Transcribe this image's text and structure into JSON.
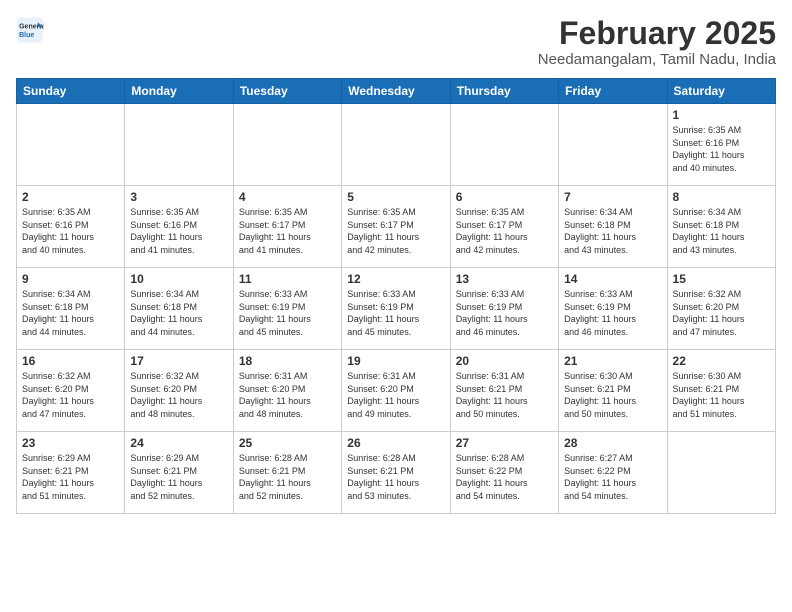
{
  "header": {
    "logo_line1": "General",
    "logo_line2": "Blue",
    "month": "February 2025",
    "location": "Needamangalam, Tamil Nadu, India"
  },
  "days_of_week": [
    "Sunday",
    "Monday",
    "Tuesday",
    "Wednesday",
    "Thursday",
    "Friday",
    "Saturday"
  ],
  "weeks": [
    [
      {
        "day": "",
        "info": ""
      },
      {
        "day": "",
        "info": ""
      },
      {
        "day": "",
        "info": ""
      },
      {
        "day": "",
        "info": ""
      },
      {
        "day": "",
        "info": ""
      },
      {
        "day": "",
        "info": ""
      },
      {
        "day": "1",
        "info": "Sunrise: 6:35 AM\nSunset: 6:16 PM\nDaylight: 11 hours\nand 40 minutes."
      }
    ],
    [
      {
        "day": "2",
        "info": "Sunrise: 6:35 AM\nSunset: 6:16 PM\nDaylight: 11 hours\nand 40 minutes."
      },
      {
        "day": "3",
        "info": "Sunrise: 6:35 AM\nSunset: 6:16 PM\nDaylight: 11 hours\nand 41 minutes."
      },
      {
        "day": "4",
        "info": "Sunrise: 6:35 AM\nSunset: 6:17 PM\nDaylight: 11 hours\nand 41 minutes."
      },
      {
        "day": "5",
        "info": "Sunrise: 6:35 AM\nSunset: 6:17 PM\nDaylight: 11 hours\nand 42 minutes."
      },
      {
        "day": "6",
        "info": "Sunrise: 6:35 AM\nSunset: 6:17 PM\nDaylight: 11 hours\nand 42 minutes."
      },
      {
        "day": "7",
        "info": "Sunrise: 6:34 AM\nSunset: 6:18 PM\nDaylight: 11 hours\nand 43 minutes."
      },
      {
        "day": "8",
        "info": "Sunrise: 6:34 AM\nSunset: 6:18 PM\nDaylight: 11 hours\nand 43 minutes."
      }
    ],
    [
      {
        "day": "9",
        "info": "Sunrise: 6:34 AM\nSunset: 6:18 PM\nDaylight: 11 hours\nand 44 minutes."
      },
      {
        "day": "10",
        "info": "Sunrise: 6:34 AM\nSunset: 6:18 PM\nDaylight: 11 hours\nand 44 minutes."
      },
      {
        "day": "11",
        "info": "Sunrise: 6:33 AM\nSunset: 6:19 PM\nDaylight: 11 hours\nand 45 minutes."
      },
      {
        "day": "12",
        "info": "Sunrise: 6:33 AM\nSunset: 6:19 PM\nDaylight: 11 hours\nand 45 minutes."
      },
      {
        "day": "13",
        "info": "Sunrise: 6:33 AM\nSunset: 6:19 PM\nDaylight: 11 hours\nand 46 minutes."
      },
      {
        "day": "14",
        "info": "Sunrise: 6:33 AM\nSunset: 6:19 PM\nDaylight: 11 hours\nand 46 minutes."
      },
      {
        "day": "15",
        "info": "Sunrise: 6:32 AM\nSunset: 6:20 PM\nDaylight: 11 hours\nand 47 minutes."
      }
    ],
    [
      {
        "day": "16",
        "info": "Sunrise: 6:32 AM\nSunset: 6:20 PM\nDaylight: 11 hours\nand 47 minutes."
      },
      {
        "day": "17",
        "info": "Sunrise: 6:32 AM\nSunset: 6:20 PM\nDaylight: 11 hours\nand 48 minutes."
      },
      {
        "day": "18",
        "info": "Sunrise: 6:31 AM\nSunset: 6:20 PM\nDaylight: 11 hours\nand 48 minutes."
      },
      {
        "day": "19",
        "info": "Sunrise: 6:31 AM\nSunset: 6:20 PM\nDaylight: 11 hours\nand 49 minutes."
      },
      {
        "day": "20",
        "info": "Sunrise: 6:31 AM\nSunset: 6:21 PM\nDaylight: 11 hours\nand 50 minutes."
      },
      {
        "day": "21",
        "info": "Sunrise: 6:30 AM\nSunset: 6:21 PM\nDaylight: 11 hours\nand 50 minutes."
      },
      {
        "day": "22",
        "info": "Sunrise: 6:30 AM\nSunset: 6:21 PM\nDaylight: 11 hours\nand 51 minutes."
      }
    ],
    [
      {
        "day": "23",
        "info": "Sunrise: 6:29 AM\nSunset: 6:21 PM\nDaylight: 11 hours\nand 51 minutes."
      },
      {
        "day": "24",
        "info": "Sunrise: 6:29 AM\nSunset: 6:21 PM\nDaylight: 11 hours\nand 52 minutes."
      },
      {
        "day": "25",
        "info": "Sunrise: 6:28 AM\nSunset: 6:21 PM\nDaylight: 11 hours\nand 52 minutes."
      },
      {
        "day": "26",
        "info": "Sunrise: 6:28 AM\nSunset: 6:21 PM\nDaylight: 11 hours\nand 53 minutes."
      },
      {
        "day": "27",
        "info": "Sunrise: 6:28 AM\nSunset: 6:22 PM\nDaylight: 11 hours\nand 54 minutes."
      },
      {
        "day": "28",
        "info": "Sunrise: 6:27 AM\nSunset: 6:22 PM\nDaylight: 11 hours\nand 54 minutes."
      },
      {
        "day": "",
        "info": ""
      }
    ]
  ]
}
